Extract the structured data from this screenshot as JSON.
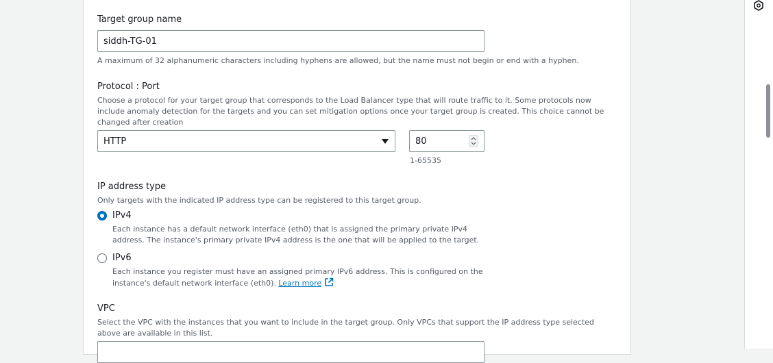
{
  "target_group_name": {
    "label": "Target group name",
    "value": "siddh-TG-01",
    "hint": "A maximum of 32 alphanumeric characters including hyphens are allowed, but the name must not begin or end with a hyphen."
  },
  "protocol_port": {
    "label": "Protocol : Port",
    "description": "Choose a protocol for your target group that corresponds to the Load Balancer type that will route traffic to it. Some protocols now include anomaly detection for the targets and you can set mitigation options once your target group is created. This choice cannot be changed after creation",
    "protocol_value": "HTTP",
    "port_value": "80",
    "port_hint": "1-65535"
  },
  "ip_address_type": {
    "label": "IP address type",
    "description": "Only targets with the indicated IP address type can be registered to this target group.",
    "options": [
      {
        "label": "IPv4",
        "selected": true,
        "description": "Each instance has a default network interface (eth0) that is assigned the primary private IPv4 address. The instance's primary private IPv4 address is the one that will be applied to the target."
      },
      {
        "label": "IPv6",
        "selected": false,
        "description": "Each instance you register must have an assigned primary IPv6 address. This is configured on the instance's default network interface (eth0).",
        "link": "Learn more"
      }
    ]
  },
  "vpc": {
    "label": "VPC",
    "description": "Select the VPC with the instances that you want to include in the target group. Only VPCs that support the IP address type selected above are available in this list."
  },
  "icons": {
    "rail": "help-hexagon-icon",
    "dropdown": "caret-down-icon",
    "stepper": "stepper-arrows-icon",
    "external": "external-link-icon"
  },
  "colors": {
    "accent": "#0073bb",
    "text": "#16191f",
    "muted": "#545b64",
    "border": "#879596"
  }
}
